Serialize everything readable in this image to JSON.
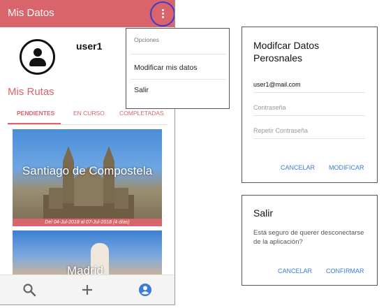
{
  "app": {
    "title": "Mis Datos",
    "username": "user1",
    "section_title": "Mis Rutas",
    "accent_color": "#d9646b"
  },
  "tabs": [
    {
      "label": "PENDIENTES",
      "active": true
    },
    {
      "label": "EN CURSO",
      "active": false
    },
    {
      "label": "COMPLETADAS",
      "active": false
    }
  ],
  "cards": [
    {
      "name": "Santiago de Compostela",
      "dates": "Del 04-Jul-2018 al 07-Jul-2018 (4 días)"
    },
    {
      "name": "Madrid"
    }
  ],
  "menu": {
    "header": "Opciones",
    "items": [
      "Modificar mis datos",
      "Salir"
    ]
  },
  "edit_dialog": {
    "title": "Modifcar Datos Perosnales",
    "email_value": "user1@mail.com",
    "password_placeholder": "Contraseña",
    "repeat_password_placeholder": "Repetir Contraseña",
    "cancel_label": "CANCELAR",
    "confirm_label": "MODIFICAR"
  },
  "logout_dialog": {
    "title": "Salir",
    "message": "Está seguro de querer desconectarse de la aplicación?",
    "cancel_label": "CANCELAR",
    "confirm_label": "CONFIRMAR"
  },
  "bottom_nav": {
    "icons": [
      "search-icon",
      "add-icon",
      "account-icon"
    ],
    "active_icon_color": "#3a7be0"
  }
}
